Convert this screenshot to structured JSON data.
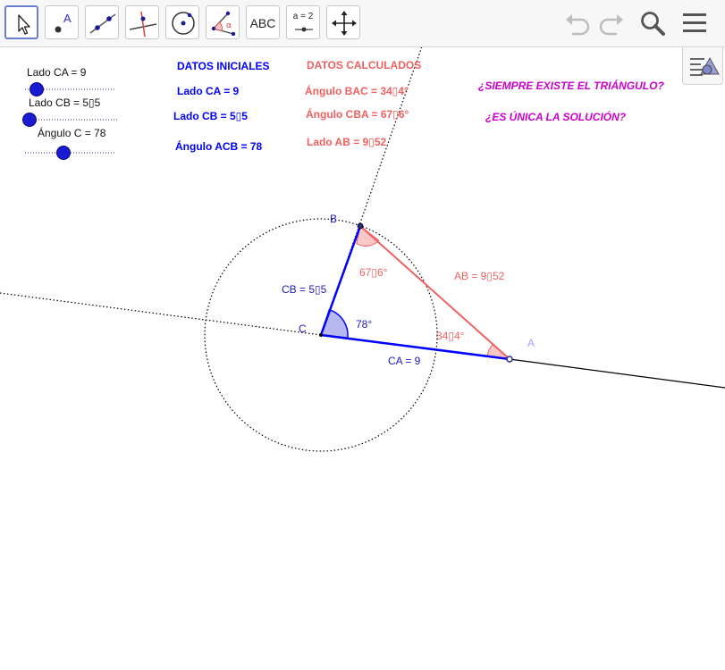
{
  "toolbar": {
    "tools": [
      {
        "name": "move-tool-button",
        "icon": "arrow-cursor-icon"
      },
      {
        "name": "point-tool-button",
        "icon": "point-a-icon",
        "glyph": "A"
      },
      {
        "name": "line-tool-button",
        "icon": "line-through-points-icon"
      },
      {
        "name": "perpendicular-tool-button",
        "icon": "perpendicular-line-icon"
      },
      {
        "name": "circle-tool-button",
        "icon": "circle-center-point-icon"
      },
      {
        "name": "angle-tool-button",
        "icon": "angle-alpha-icon",
        "glyph": "α"
      },
      {
        "name": "text-tool-button",
        "icon": "text-abc-icon",
        "glyph": "ABC"
      },
      {
        "name": "slider-tool-button",
        "icon": "slider-a2-icon",
        "glyph": "a = 2"
      },
      {
        "name": "move-view-button",
        "icon": "move-graphics-view-icon"
      }
    ],
    "right_icons": [
      "undo-icon",
      "redo-icon",
      "search-icon",
      "menu-icon"
    ]
  },
  "sliders": [
    {
      "label": "Lado CA = 9",
      "fraction": 0.12
    },
    {
      "label": "Lado CB = 5▯5",
      "fraction": 0.05
    },
    {
      "label": "Ángulo C = 78",
      "fraction": 0.43
    }
  ],
  "datos_iniciales": {
    "title": "DATOS INICIALES",
    "lado_ca": "Lado CA  =  9",
    "lado_cb": "Lado CB  =  5▯5",
    "angulo_acb": "Ángulo ACB  =  78"
  },
  "datos_calculados": {
    "title": "DATOS CALCULADOS",
    "angulo_bac": "Ángulo BAC  =  34▯4°",
    "angulo_cba": "Ángulo CBA  =  67▯6°",
    "lado_ab": "Lado AB  =  9▯52"
  },
  "questions": {
    "q1": "¿SIEMPRE EXISTE EL TRIÁNGULO?",
    "q2": "¿ES ÚNICA LA SOLUCIÓN?"
  },
  "figure": {
    "point_b": "B",
    "point_c": "C",
    "point_a": "A",
    "seg_cb": "CB = 5▯5",
    "seg_ca": "CA = 9",
    "seg_ab": "AB = 9▯52",
    "angle_c": "78°",
    "angle_b": "67▯6°",
    "angle_a": "34▯4°"
  },
  "colors": {
    "blue": "#0000ff",
    "red": "#f06060",
    "magenta": "#cc00cc",
    "angle_fill": "#b8b8f0",
    "red_fill": "#f8c8c8"
  }
}
